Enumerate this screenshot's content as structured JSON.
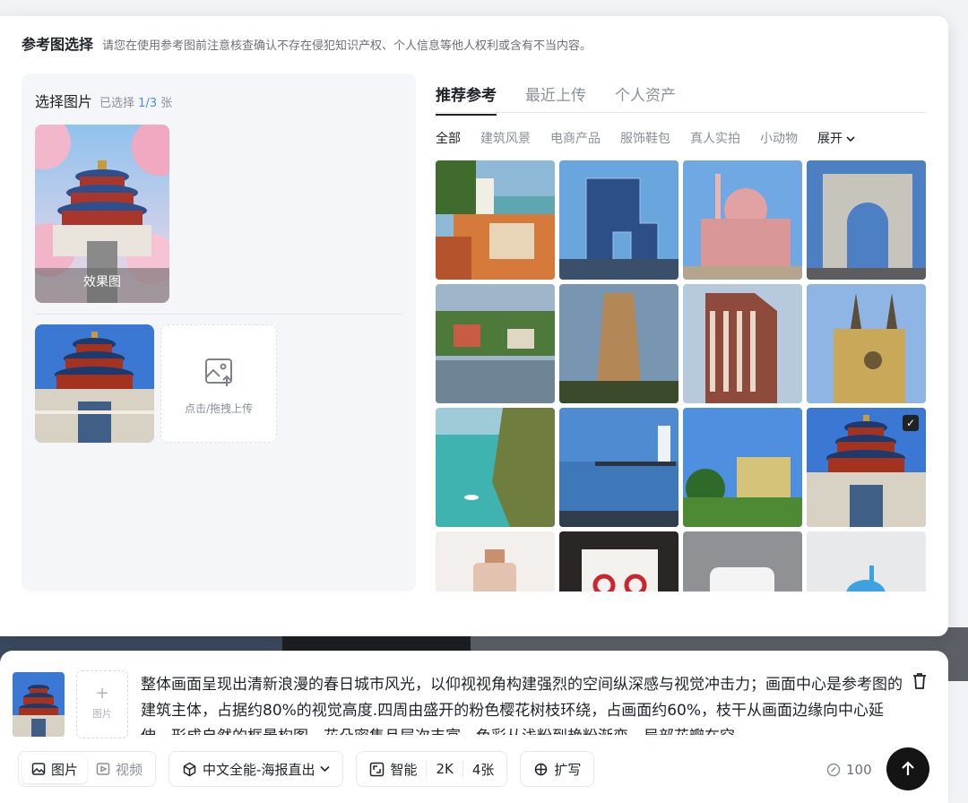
{
  "header": {
    "title": "参考图选择",
    "notice": "请您在使用参考图前注意核查确认不存在侵犯知识产权、个人信息等他人权利或含有不当内容。"
  },
  "left_panel": {
    "title": "选择图片",
    "selected_prefix": "已选择",
    "selected_count": "1/3",
    "selected_suffix": "张",
    "result_label": "效果图",
    "upload_label": "点击/拖拽上传"
  },
  "right_panel": {
    "tabs": [
      "推荐参考",
      "最近上传",
      "个人资产"
    ],
    "active_tab": 0,
    "filters": [
      "全部",
      "建筑风景",
      "电商产品",
      "服饰鞋包",
      "真人实拍",
      "小动物"
    ],
    "active_filter": 0,
    "expand_label": "展开",
    "grid": [
      {
        "name": "harbor-town-image",
        "selected": false
      },
      {
        "name": "cctv-tower-image",
        "selected": false
      },
      {
        "name": "pink-mosque-image",
        "selected": false
      },
      {
        "name": "arc-de-triomphe-image",
        "selected": false
      },
      {
        "name": "lakeside-village-image",
        "selected": false
      },
      {
        "name": "pagoda-image",
        "selected": false
      },
      {
        "name": "flatiron-building-image",
        "selected": false
      },
      {
        "name": "cathedral-image",
        "selected": false
      },
      {
        "name": "coastal-cliff-image",
        "selected": false
      },
      {
        "name": "pier-lighthouse-image",
        "selected": false
      },
      {
        "name": "yellow-castle-image",
        "selected": false
      },
      {
        "name": "temple-of-heaven-image",
        "selected": true
      },
      {
        "name": "perfume-bottle-image",
        "selected": false
      },
      {
        "name": "earrings-image",
        "selected": false
      },
      {
        "name": "cosmetic-jar-image",
        "selected": false
      },
      {
        "name": "blue-toy-image",
        "selected": false
      }
    ]
  },
  "composer": {
    "add_image_plus": "+",
    "add_image_label": "图片",
    "prompt_text": "整体画面呈现出清新浪漫的春日城市风光，以仰视视角构建强烈的空间纵深感与视觉冲击力；画面中心是参考图的建筑主体，占据约80%的视觉高度.四周由盛开的粉色樱花树枝环绕，占画面约60%，枝干从画面边缘向中心延伸，形成自然的框景构图，花朵密集且层次丰富，色彩从浅粉到艳粉渐变，局部花瓣在空"
  },
  "toolbar": {
    "image_tab": "图片",
    "video_tab": "视频",
    "model": "中文全能-海报直出",
    "ratio": "智能",
    "resolution": "2K",
    "count": "4张",
    "expand_prompt": "扩写",
    "credits": "100"
  }
}
